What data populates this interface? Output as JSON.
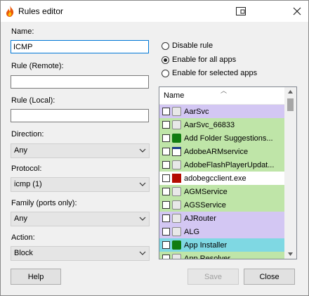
{
  "window": {
    "title": "Rules editor"
  },
  "form": {
    "name_label": "Name:",
    "name_value": "ICMP",
    "remote_label": "Rule (Remote):",
    "remote_value": "",
    "local_label": "Rule (Local):",
    "local_value": "",
    "direction_label": "Direction:",
    "direction_value": "Any",
    "protocol_label": "Protocol:",
    "protocol_value": "icmp (1)",
    "family_label": "Family (ports only):",
    "family_value": "Any",
    "action_label": "Action:",
    "action_value": "Block"
  },
  "mode": {
    "options": [
      "Disable rule",
      "Enable for all apps",
      "Enable for selected apps"
    ],
    "selected": "Enable for all apps"
  },
  "apps": {
    "column_name": "Name",
    "items": [
      {
        "label": "AarSvc",
        "color": "#d3c7f3",
        "icon": "service-icon"
      },
      {
        "label": "AarSvc_66833",
        "color": "#bfe5a8",
        "icon": "service-icon"
      },
      {
        "label": "Add Folder Suggestions...",
        "color": "#bfe5a8",
        "icon": "store-bag-icon"
      },
      {
        "label": "AdobeARMservice",
        "color": "#bfe5a8",
        "icon": "window-icon"
      },
      {
        "label": "AdobeFlashPlayerUpdat...",
        "color": "#bfe5a8",
        "icon": "service-icon"
      },
      {
        "label": "adobegcclient.exe",
        "color": "#ffffff",
        "icon": "adobe-icon"
      },
      {
        "label": "AGMService",
        "color": "#bfe5a8",
        "icon": "service-icon"
      },
      {
        "label": "AGSService",
        "color": "#bfe5a8",
        "icon": "service-icon"
      },
      {
        "label": "AJRouter",
        "color": "#d3c7f3",
        "icon": "service-icon"
      },
      {
        "label": "ALG",
        "color": "#d3c7f3",
        "icon": "service-icon"
      },
      {
        "label": "App Installer",
        "color": "#7fd8e3",
        "icon": "store-bag-icon"
      },
      {
        "label": "App Resolver",
        "color": "#bfe5a8",
        "icon": "service-icon"
      }
    ]
  },
  "buttons": {
    "help": "Help",
    "save": "Save",
    "close": "Close"
  }
}
